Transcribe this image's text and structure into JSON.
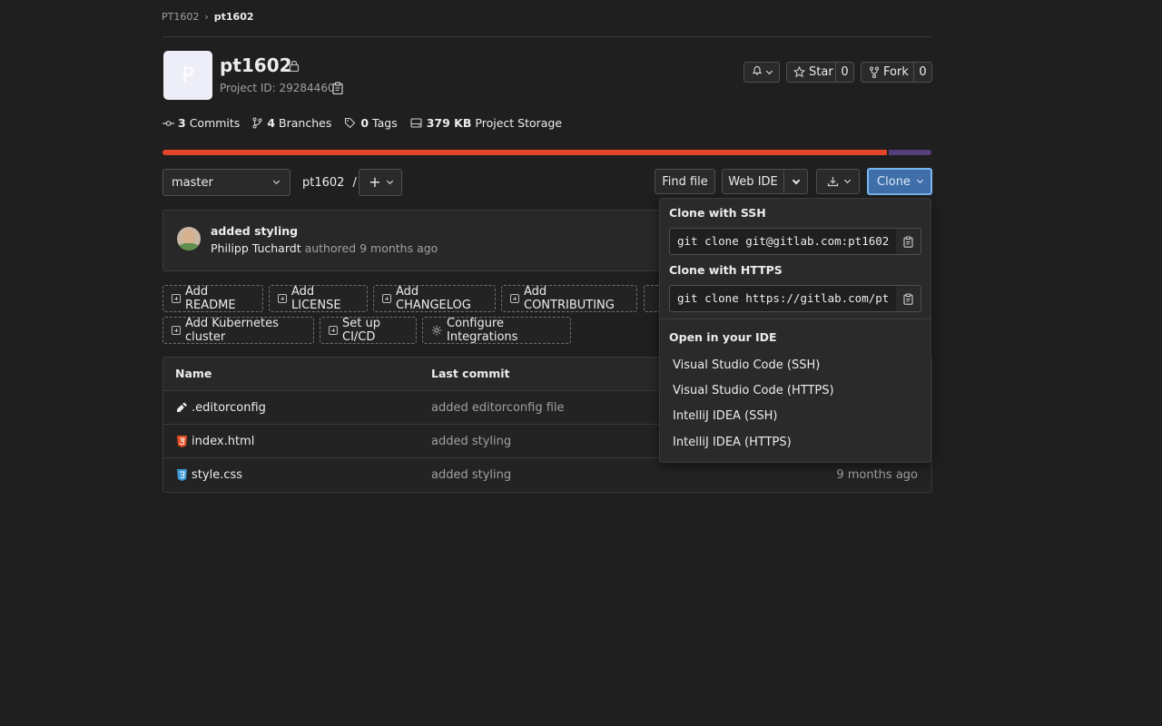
{
  "breadcrumb": {
    "parent": "PT1602",
    "current": "pt1602"
  },
  "project": {
    "avatar_letter": "P",
    "name": "pt1602",
    "id_label": "Project ID: 29284460"
  },
  "actions": {
    "star_label": "Star",
    "star_count": "0",
    "fork_label": "Fork",
    "fork_count": "0"
  },
  "stats": {
    "commits_count": "3",
    "commits_label": "Commits",
    "branches_count": "4",
    "branches_label": "Branches",
    "tags_count": "0",
    "tags_label": "Tags",
    "storage_size": "379 KB",
    "storage_label": "Project Storage"
  },
  "language_bar": {
    "segments": [
      {
        "color": "#e24329",
        "fraction": 0.944
      },
      {
        "color": "#563d7c",
        "fraction": 0.056
      }
    ]
  },
  "toolbar": {
    "branch": "master",
    "path_repo": "pt1602",
    "path_sep": "/",
    "find_file": "Find file",
    "web_ide": "Web IDE",
    "clone": "Clone"
  },
  "last_commit": {
    "title": "added styling",
    "author": "Philipp Tuchardt",
    "meta": "authored 9 months ago"
  },
  "quick_actions": [
    "Add README",
    "Add LICENSE",
    "Add CHANGELOG",
    "Add CONTRIBUTING",
    "Add Kubernetes cluster",
    "Set up CI/CD",
    "Configure Integrations"
  ],
  "table": {
    "headers": {
      "name": "Name",
      "last_commit": "Last commit"
    },
    "rows": [
      {
        "name": ".editorconfig",
        "commit": "added editorconfig file",
        "updated": "",
        "icon": "editorconfig-icon",
        "icon_color": "#ececec"
      },
      {
        "name": "index.html",
        "commit": "added styling",
        "updated": "",
        "icon": "html5-icon",
        "icon_color": "#e44d26"
      },
      {
        "name": "style.css",
        "commit": "added styling",
        "updated": "9 months ago",
        "icon": "css3-icon",
        "icon_color": "#3d9ad6"
      }
    ]
  },
  "clone_dropdown": {
    "ssh_title": "Clone with SSH",
    "ssh_value": "git clone git@gitlab.com:pt1602",
    "https_title": "Clone with HTTPS",
    "https_value": "git clone https://gitlab.com/pt",
    "ide_title": "Open in your IDE",
    "ide_items": [
      "Visual Studio Code (SSH)",
      "Visual Studio Code (HTTPS)",
      "IntelliJ IDEA (SSH)",
      "IntelliJ IDEA (HTTPS)"
    ]
  },
  "colors": {
    "accent": "#428fdc",
    "accent_bg": "#1f75cb",
    "bg": "#1f1f1f",
    "border": "#3a3a3a"
  }
}
